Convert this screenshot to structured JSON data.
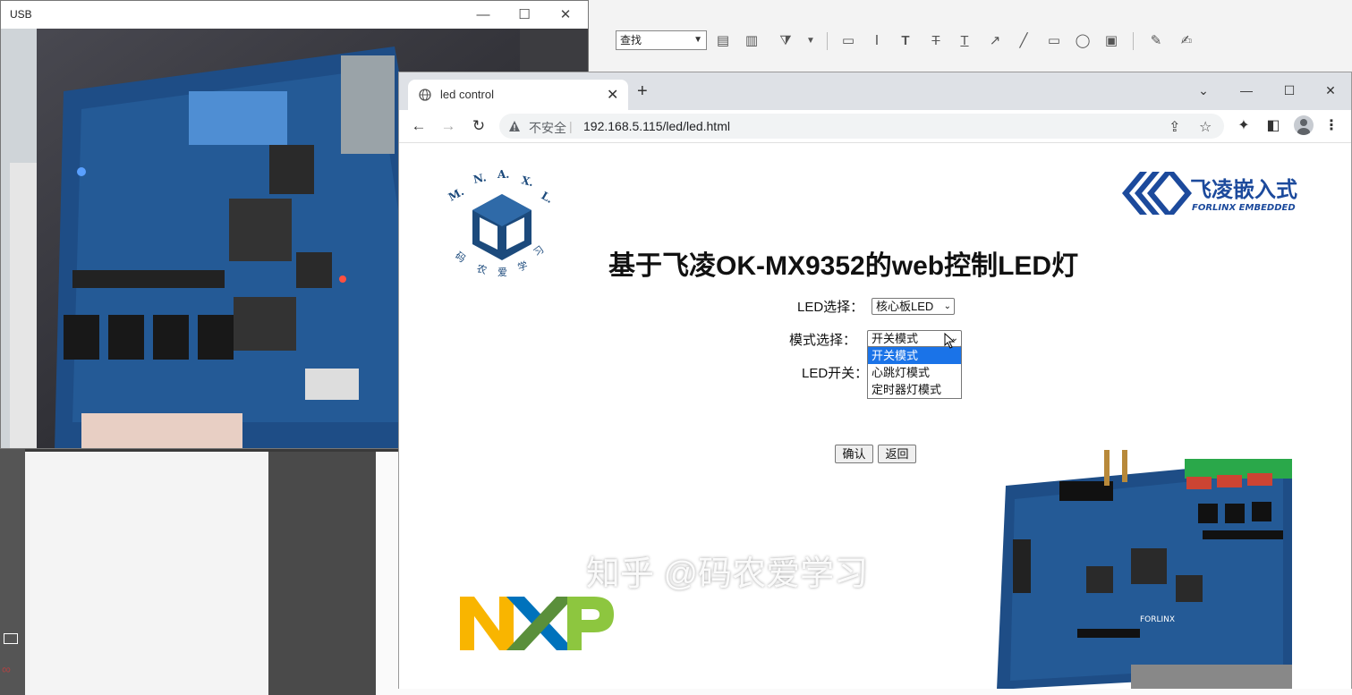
{
  "usb_window": {
    "title": "USB",
    "minimize": "—",
    "maximize": "☐",
    "close": "✕"
  },
  "background_toolbar": {
    "search_combo_value": "查找"
  },
  "browser": {
    "tab_title": "led control",
    "tab_close": "✕",
    "new_tab": "+",
    "window_controls": {
      "menu": "⌄",
      "minimize": "—",
      "maximize": "☐",
      "close": "✕"
    },
    "nav": {
      "back": "←",
      "forward": "→",
      "reload": "↻"
    },
    "address": {
      "security_label": "不安全",
      "separator": "|",
      "url": "192.168.5.115/led/led.html"
    }
  },
  "page": {
    "heading": "基于飞凌OK-MX9352的web控制LED灯",
    "led_select": {
      "label": "LED选择：",
      "value": "核心板LED"
    },
    "mode_select": {
      "label": "模式选择：",
      "value": "开关模式",
      "options": [
        "开关模式",
        "心跳灯模式",
        "定时器灯模式"
      ],
      "highlighted": "开关模式"
    },
    "led_switch": {
      "label": "LED开关："
    },
    "confirm_button": "确认",
    "back_button": "返回",
    "logos": {
      "forlinx_cn": "飞凌嵌入式",
      "forlinx_en": "FORLINX EMBEDDED",
      "mnaxl_letters": "M. N. A. X. L.",
      "mnaxl_cn": "码农爱学习"
    }
  },
  "overlay_watermark": "知乎 @码农爱学习",
  "colors": {
    "accent_blue": "#1a73e8",
    "nxp_yellow": "#f9b500",
    "nxp_blue": "#0072bc",
    "nxp_green": "#8dc63f",
    "forlinx_blue": "#1c4a9c",
    "pcb_blue": "#1e4d86"
  }
}
